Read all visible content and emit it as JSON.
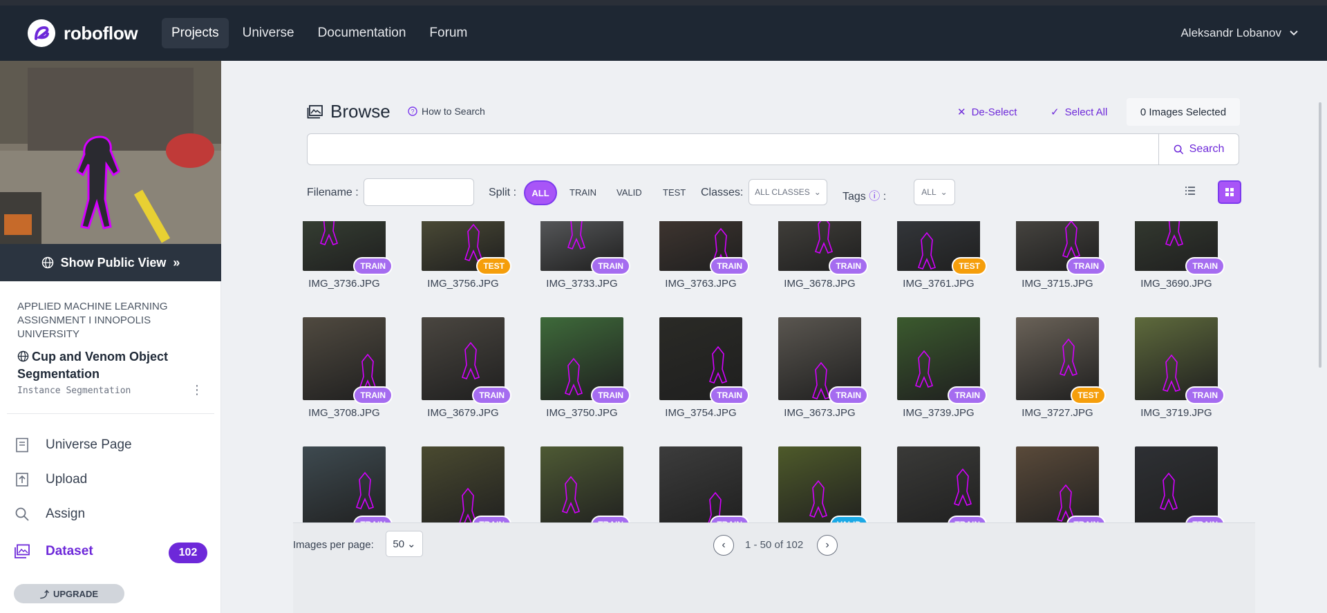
{
  "nav": {
    "brand": "roboflow",
    "links": [
      "Projects",
      "Universe",
      "Documentation",
      "Forum"
    ],
    "user": "Aleksandr Lobanov"
  },
  "sidebar": {
    "public_view": "Show Public View",
    "workspace": "APPLIED MACHINE LEARNING ASSIGNMENT I INNOPOLIS UNIVERSITY",
    "project_title": "Cup and Venom Object Segmentation",
    "project_type": "Instance Segmentation",
    "items": [
      {
        "label": "Universe Page",
        "icon": "book-icon"
      },
      {
        "label": "Upload",
        "icon": "upload-icon"
      },
      {
        "label": "Assign",
        "icon": "search-icon"
      },
      {
        "label": "Dataset",
        "icon": "images-icon",
        "count": "102"
      }
    ],
    "upgrade": "UPGRADE"
  },
  "browse": {
    "title": "Browse",
    "how_to_search": "How to Search",
    "deselect": "De-Select",
    "select_all": "Select All",
    "selected_count": "0 Images Selected",
    "search_placeholder": "",
    "search_button": "Search"
  },
  "filters": {
    "filename_label": "Filename :",
    "split_label": "Split :",
    "split_options": [
      "ALL",
      "TRAIN",
      "VALID",
      "TEST"
    ],
    "classes_label": "Classes:",
    "classes_value": "ALL CLASSES",
    "tags_label": "Tags",
    "tags_value": "ALL"
  },
  "images": [
    {
      "name": "IMG_3736.JPG",
      "split": "TRAIN",
      "color": "#3e4a3a"
    },
    {
      "name": "IMG_3756.JPG",
      "split": "TEST",
      "color": "#5b5a3e"
    },
    {
      "name": "IMG_3733.JPG",
      "split": "TRAIN",
      "color": "#6b6d70"
    },
    {
      "name": "IMG_3763.JPG",
      "split": "TRAIN",
      "color": "#4a3d36"
    },
    {
      "name": "IMG_3678.JPG",
      "split": "TRAIN",
      "color": "#4d4a44"
    },
    {
      "name": "IMG_3761.JPG",
      "split": "TEST",
      "color": "#3b3f45"
    },
    {
      "name": "IMG_3715.JPG",
      "split": "TRAIN",
      "color": "#55524c"
    },
    {
      "name": "IMG_3690.JPG",
      "split": "TRAIN",
      "color": "#3a4235"
    },
    {
      "name": "IMG_3708.JPG",
      "split": "TRAIN",
      "color": "#504a40"
    },
    {
      "name": "IMG_3679.JPG",
      "split": "TRAIN",
      "color": "#4a4640"
    },
    {
      "name": "IMG_3750.JPG",
      "split": "TRAIN",
      "color": "#3e6a3a"
    },
    {
      "name": "IMG_3754.JPG",
      "split": "TRAIN",
      "color": "#2a2a26"
    },
    {
      "name": "IMG_3673.JPG",
      "split": "TRAIN",
      "color": "#5a5650"
    },
    {
      "name": "IMG_3739.JPG",
      "split": "TRAIN",
      "color": "#3b5a2e"
    },
    {
      "name": "IMG_3727.JPG",
      "split": "TEST",
      "color": "#6a6258"
    },
    {
      "name": "IMG_3719.JPG",
      "split": "TRAIN",
      "color": "#5e6a3c"
    },
    {
      "name": "",
      "split": "TRAIN",
      "color": "#3e4a50"
    },
    {
      "name": "",
      "split": "TRAIN",
      "color": "#4a4a30"
    },
    {
      "name": "",
      "split": "TRAIN",
      "color": "#4e5a34"
    },
    {
      "name": "",
      "split": "TRAIN",
      "color": "#3c3c3c"
    },
    {
      "name": "",
      "split": "VALID",
      "color": "#4e5a2a"
    },
    {
      "name": "",
      "split": "TRAIN",
      "color": "#3a3a38"
    },
    {
      "name": "",
      "split": "TRAIN",
      "color": "#5a4a3a"
    },
    {
      "name": "",
      "split": "TRAIN",
      "color": "#2e3034"
    }
  ],
  "pagination": {
    "per_page_label": "Images per page:",
    "per_page": "50",
    "range": "1 - 50 of 102"
  },
  "colors": {
    "accent": "#6d28d9",
    "accent_light": "#a855f7",
    "nav_bg": "#1e2733"
  }
}
